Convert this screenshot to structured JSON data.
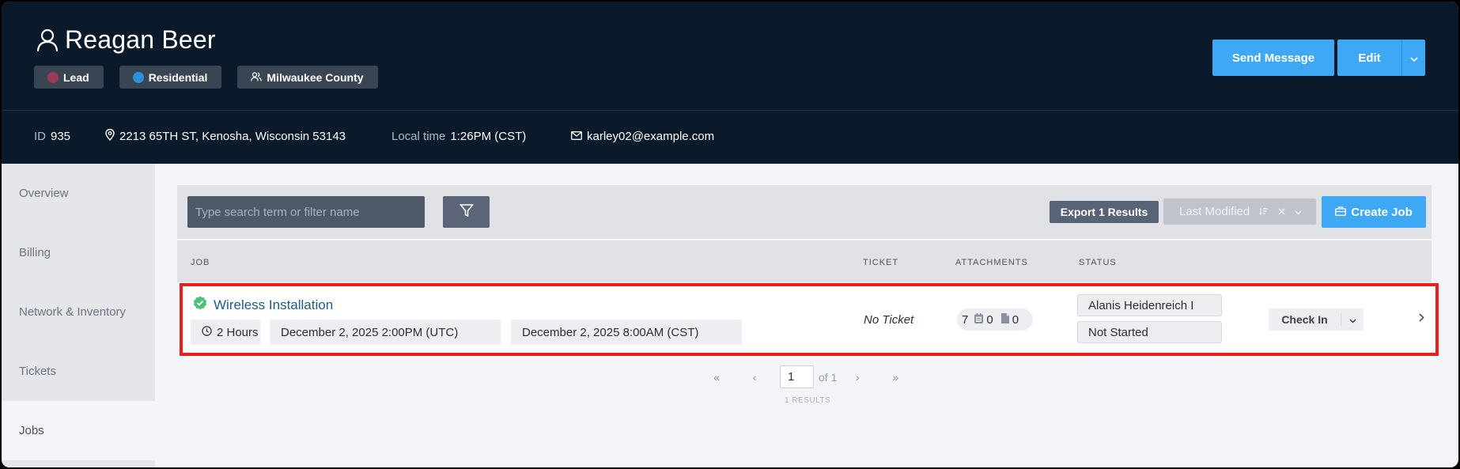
{
  "customer": {
    "name": "Reagan Beer",
    "tags": [
      {
        "label": "Lead",
        "dot_color": "#9b3a55"
      },
      {
        "label": "Residential",
        "dot_color": "#2e8fd8"
      },
      {
        "label": "Milwaukee County",
        "icon": "people-icon"
      }
    ],
    "id_label": "ID",
    "id": "935",
    "address": "2213 65TH ST, Kenosha, Wisconsin 53143",
    "local_time_label": "Local time",
    "local_time": "1:26PM (CST)",
    "email": "karley02@example.com"
  },
  "header_actions": {
    "send_message": "Send Message",
    "edit": "Edit"
  },
  "sidebar": {
    "items": [
      {
        "label": "Overview"
      },
      {
        "label": "Billing"
      },
      {
        "label": "Network & Inventory"
      },
      {
        "label": "Tickets"
      },
      {
        "label": "Jobs",
        "active": true
      }
    ]
  },
  "toolbar": {
    "search_placeholder": "Type search term or filter name",
    "export": "Export 1 Results",
    "sort": "Last Modified",
    "create_job": "Create Job"
  },
  "table": {
    "columns": [
      "JOB",
      "TICKET",
      "ATTACHMENTS",
      "STATUS"
    ],
    "rows": [
      {
        "title": "Wireless Installation",
        "duration": "2 Hours",
        "start_utc": "December 2, 2025 2:00PM (UTC)",
        "start_local": "December 2, 2025 8:00AM (CST)",
        "ticket": "No Ticket",
        "attachments_count": "7",
        "calendar_count": "0",
        "file_count": "0",
        "assignee": "Alanis Heidenreich I",
        "status": "Not Started",
        "action": "Check In"
      }
    ]
  },
  "pagination": {
    "current_page": "1",
    "of_text": "of 1",
    "results_text": "1 RESULTS"
  },
  "colors": {
    "header_bg": "#0b1a2b",
    "accent": "#3ea8f5",
    "highlight": "#e4221b",
    "success": "#4cc17a"
  }
}
